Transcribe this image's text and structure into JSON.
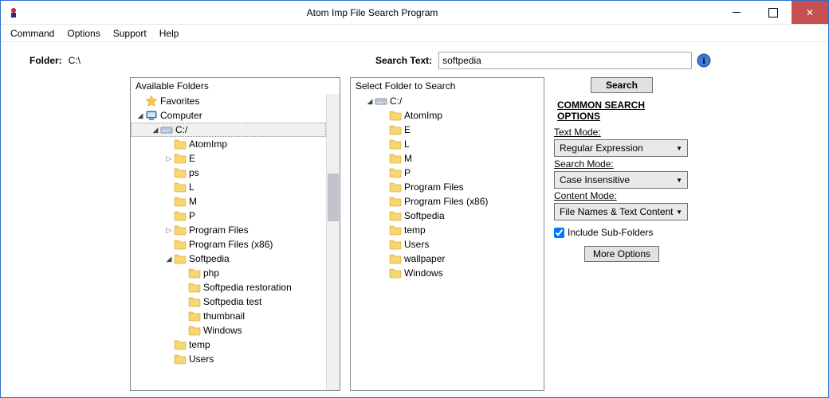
{
  "window": {
    "title": "Atom Imp File Search Program"
  },
  "menu": {
    "items": [
      "Command",
      "Options",
      "Support",
      "Help"
    ]
  },
  "folder": {
    "label": "Folder:",
    "value": "C:\\"
  },
  "search": {
    "label": "Search Text:",
    "value": "softpedia"
  },
  "available": {
    "title": "Available Folders",
    "tree": [
      {
        "indent": 0,
        "twisty": "none",
        "icon": "star",
        "label": "Favorites"
      },
      {
        "indent": 0,
        "twisty": "expanded",
        "icon": "computer",
        "label": "Computer"
      },
      {
        "indent": 1,
        "twisty": "expanded",
        "icon": "drive",
        "label": "C:/",
        "sel": true
      },
      {
        "indent": 2,
        "twisty": "none",
        "icon": "folder",
        "label": "AtomImp"
      },
      {
        "indent": 2,
        "twisty": "collapsed",
        "icon": "folder",
        "label": "E"
      },
      {
        "indent": 2,
        "twisty": "none",
        "icon": "folder",
        "label": "               ps"
      },
      {
        "indent": 2,
        "twisty": "none",
        "icon": "folder",
        "label": "L"
      },
      {
        "indent": 2,
        "twisty": "none",
        "icon": "folder",
        "label": "M"
      },
      {
        "indent": 2,
        "twisty": "none",
        "icon": "folder",
        "label": "P"
      },
      {
        "indent": 2,
        "twisty": "collapsed",
        "icon": "folder",
        "label": "Program Files"
      },
      {
        "indent": 2,
        "twisty": "none",
        "icon": "folder",
        "label": "Program Files (x86)"
      },
      {
        "indent": 2,
        "twisty": "expanded",
        "icon": "folder",
        "label": "Softpedia"
      },
      {
        "indent": 3,
        "twisty": "none",
        "icon": "folder",
        "label": "php"
      },
      {
        "indent": 3,
        "twisty": "none",
        "icon": "folder",
        "label": "Softpedia restoration"
      },
      {
        "indent": 3,
        "twisty": "none",
        "icon": "folder",
        "label": "Softpedia test"
      },
      {
        "indent": 3,
        "twisty": "none",
        "icon": "folder",
        "label": "thumbnail"
      },
      {
        "indent": 3,
        "twisty": "none",
        "icon": "folder",
        "label": "Windows"
      },
      {
        "indent": 2,
        "twisty": "none",
        "icon": "folder",
        "label": "temp"
      },
      {
        "indent": 2,
        "twisty": "none",
        "icon": "folder",
        "label": "Users"
      }
    ]
  },
  "select": {
    "title": "Select Folder to Search",
    "tree": [
      {
        "indent": 0,
        "twisty": "expanded",
        "icon": "drive",
        "label": "C:/"
      },
      {
        "indent": 1,
        "twisty": "none",
        "icon": "folder",
        "label": "AtomImp"
      },
      {
        "indent": 1,
        "twisty": "none",
        "icon": "folder",
        "label": "E"
      },
      {
        "indent": 1,
        "twisty": "none",
        "icon": "folder",
        "label": "L"
      },
      {
        "indent": 1,
        "twisty": "none",
        "icon": "folder",
        "label": "M"
      },
      {
        "indent": 1,
        "twisty": "none",
        "icon": "folder",
        "label": "P"
      },
      {
        "indent": 1,
        "twisty": "none",
        "icon": "folder",
        "label": "Program Files"
      },
      {
        "indent": 1,
        "twisty": "none",
        "icon": "folder",
        "label": "Program Files (x86)"
      },
      {
        "indent": 1,
        "twisty": "none",
        "icon": "folder",
        "label": "Softpedia"
      },
      {
        "indent": 1,
        "twisty": "none",
        "icon": "folder",
        "label": "temp"
      },
      {
        "indent": 1,
        "twisty": "none",
        "icon": "folder",
        "label": "Users"
      },
      {
        "indent": 1,
        "twisty": "none",
        "icon": "folder",
        "label": "wallpaper"
      },
      {
        "indent": 1,
        "twisty": "none",
        "icon": "folder",
        "label": "Windows"
      }
    ]
  },
  "options": {
    "search_btn": "Search",
    "header": "COMMON SEARCH OPTIONS",
    "text_mode_label": "Text Mode:",
    "text_mode_value": "Regular Expression",
    "search_mode_label": "Search Mode:",
    "search_mode_value": "Case Insensitive",
    "content_mode_label": "Content Mode:",
    "content_mode_value": "File Names & Text Content",
    "include_sub_label": "Include Sub-Folders",
    "include_sub_checked": true,
    "more_btn": "More Options"
  }
}
